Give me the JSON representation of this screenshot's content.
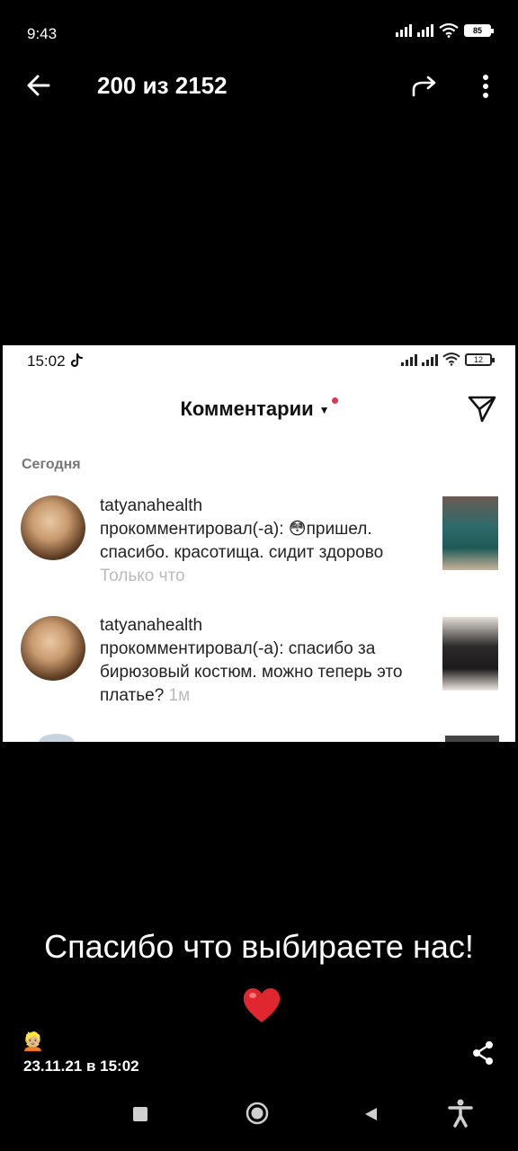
{
  "status_bar": {
    "time": "9:43",
    "battery": "85"
  },
  "top_bar": {
    "counter": "200 из 2152"
  },
  "screenshot": {
    "status_time": "15:02",
    "battery": "12",
    "title": "Комментарии",
    "section": "Сегодня",
    "comments": [
      {
        "user": "tatyanahealth",
        "text": "прокомментировал(-а): 😳пришел. спасибо. красотища. сидит здорово",
        "time": "Только что"
      },
      {
        "user": "tatyanahealth",
        "text": "прокомментировал(-а): спасибо за бирюзовый костюм. можно теперь это платье?",
        "time": "1м"
      }
    ]
  },
  "caption": "Спасибо что выбираете нас!",
  "heart": "❤️",
  "person_emoji": "👱🏼",
  "date": "23.11.21 в 15:02",
  "colors": {
    "background": "#000000",
    "notification_dot": "#e8324f"
  },
  "icons": [
    "back-arrow-icon",
    "share-icon",
    "more-vert-icon",
    "send-icon",
    "share-nodes-icon",
    "nav-square-icon",
    "nav-home-icon",
    "nav-back-icon",
    "accessibility-icon"
  ]
}
